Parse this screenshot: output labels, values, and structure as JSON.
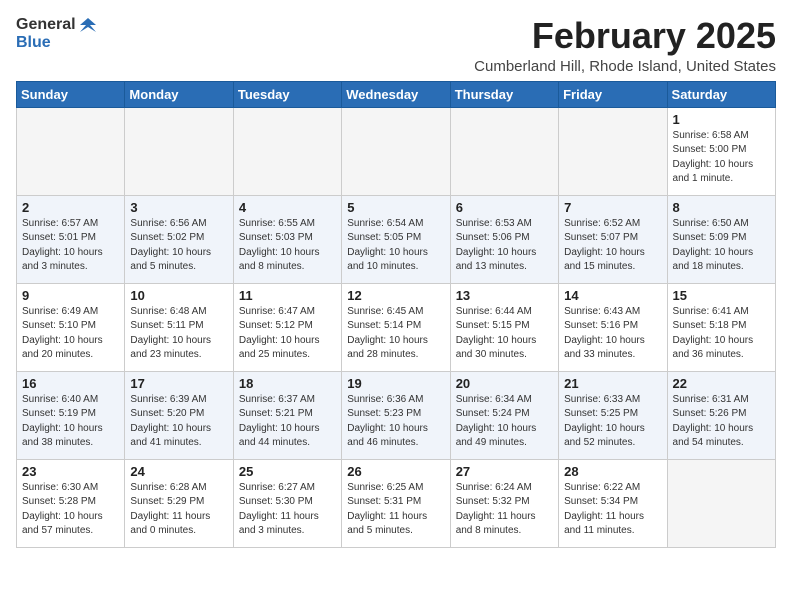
{
  "logo": {
    "general": "General",
    "blue": "Blue"
  },
  "title": "February 2025",
  "location": "Cumberland Hill, Rhode Island, United States",
  "days_of_week": [
    "Sunday",
    "Monday",
    "Tuesday",
    "Wednesday",
    "Thursday",
    "Friday",
    "Saturday"
  ],
  "weeks": [
    [
      {
        "day": "",
        "info": ""
      },
      {
        "day": "",
        "info": ""
      },
      {
        "day": "",
        "info": ""
      },
      {
        "day": "",
        "info": ""
      },
      {
        "day": "",
        "info": ""
      },
      {
        "day": "",
        "info": ""
      },
      {
        "day": "1",
        "info": "Sunrise: 6:58 AM\nSunset: 5:00 PM\nDaylight: 10 hours\nand 1 minute."
      }
    ],
    [
      {
        "day": "2",
        "info": "Sunrise: 6:57 AM\nSunset: 5:01 PM\nDaylight: 10 hours\nand 3 minutes."
      },
      {
        "day": "3",
        "info": "Sunrise: 6:56 AM\nSunset: 5:02 PM\nDaylight: 10 hours\nand 5 minutes."
      },
      {
        "day": "4",
        "info": "Sunrise: 6:55 AM\nSunset: 5:03 PM\nDaylight: 10 hours\nand 8 minutes."
      },
      {
        "day": "5",
        "info": "Sunrise: 6:54 AM\nSunset: 5:05 PM\nDaylight: 10 hours\nand 10 minutes."
      },
      {
        "day": "6",
        "info": "Sunrise: 6:53 AM\nSunset: 5:06 PM\nDaylight: 10 hours\nand 13 minutes."
      },
      {
        "day": "7",
        "info": "Sunrise: 6:52 AM\nSunset: 5:07 PM\nDaylight: 10 hours\nand 15 minutes."
      },
      {
        "day": "8",
        "info": "Sunrise: 6:50 AM\nSunset: 5:09 PM\nDaylight: 10 hours\nand 18 minutes."
      }
    ],
    [
      {
        "day": "9",
        "info": "Sunrise: 6:49 AM\nSunset: 5:10 PM\nDaylight: 10 hours\nand 20 minutes."
      },
      {
        "day": "10",
        "info": "Sunrise: 6:48 AM\nSunset: 5:11 PM\nDaylight: 10 hours\nand 23 minutes."
      },
      {
        "day": "11",
        "info": "Sunrise: 6:47 AM\nSunset: 5:12 PM\nDaylight: 10 hours\nand 25 minutes."
      },
      {
        "day": "12",
        "info": "Sunrise: 6:45 AM\nSunset: 5:14 PM\nDaylight: 10 hours\nand 28 minutes."
      },
      {
        "day": "13",
        "info": "Sunrise: 6:44 AM\nSunset: 5:15 PM\nDaylight: 10 hours\nand 30 minutes."
      },
      {
        "day": "14",
        "info": "Sunrise: 6:43 AM\nSunset: 5:16 PM\nDaylight: 10 hours\nand 33 minutes."
      },
      {
        "day": "15",
        "info": "Sunrise: 6:41 AM\nSunset: 5:18 PM\nDaylight: 10 hours\nand 36 minutes."
      }
    ],
    [
      {
        "day": "16",
        "info": "Sunrise: 6:40 AM\nSunset: 5:19 PM\nDaylight: 10 hours\nand 38 minutes."
      },
      {
        "day": "17",
        "info": "Sunrise: 6:39 AM\nSunset: 5:20 PM\nDaylight: 10 hours\nand 41 minutes."
      },
      {
        "day": "18",
        "info": "Sunrise: 6:37 AM\nSunset: 5:21 PM\nDaylight: 10 hours\nand 44 minutes."
      },
      {
        "day": "19",
        "info": "Sunrise: 6:36 AM\nSunset: 5:23 PM\nDaylight: 10 hours\nand 46 minutes."
      },
      {
        "day": "20",
        "info": "Sunrise: 6:34 AM\nSunset: 5:24 PM\nDaylight: 10 hours\nand 49 minutes."
      },
      {
        "day": "21",
        "info": "Sunrise: 6:33 AM\nSunset: 5:25 PM\nDaylight: 10 hours\nand 52 minutes."
      },
      {
        "day": "22",
        "info": "Sunrise: 6:31 AM\nSunset: 5:26 PM\nDaylight: 10 hours\nand 54 minutes."
      }
    ],
    [
      {
        "day": "23",
        "info": "Sunrise: 6:30 AM\nSunset: 5:28 PM\nDaylight: 10 hours\nand 57 minutes."
      },
      {
        "day": "24",
        "info": "Sunrise: 6:28 AM\nSunset: 5:29 PM\nDaylight: 11 hours\nand 0 minutes."
      },
      {
        "day": "25",
        "info": "Sunrise: 6:27 AM\nSunset: 5:30 PM\nDaylight: 11 hours\nand 3 minutes."
      },
      {
        "day": "26",
        "info": "Sunrise: 6:25 AM\nSunset: 5:31 PM\nDaylight: 11 hours\nand 5 minutes."
      },
      {
        "day": "27",
        "info": "Sunrise: 6:24 AM\nSunset: 5:32 PM\nDaylight: 11 hours\nand 8 minutes."
      },
      {
        "day": "28",
        "info": "Sunrise: 6:22 AM\nSunset: 5:34 PM\nDaylight: 11 hours\nand 11 minutes."
      },
      {
        "day": "",
        "info": ""
      }
    ]
  ]
}
